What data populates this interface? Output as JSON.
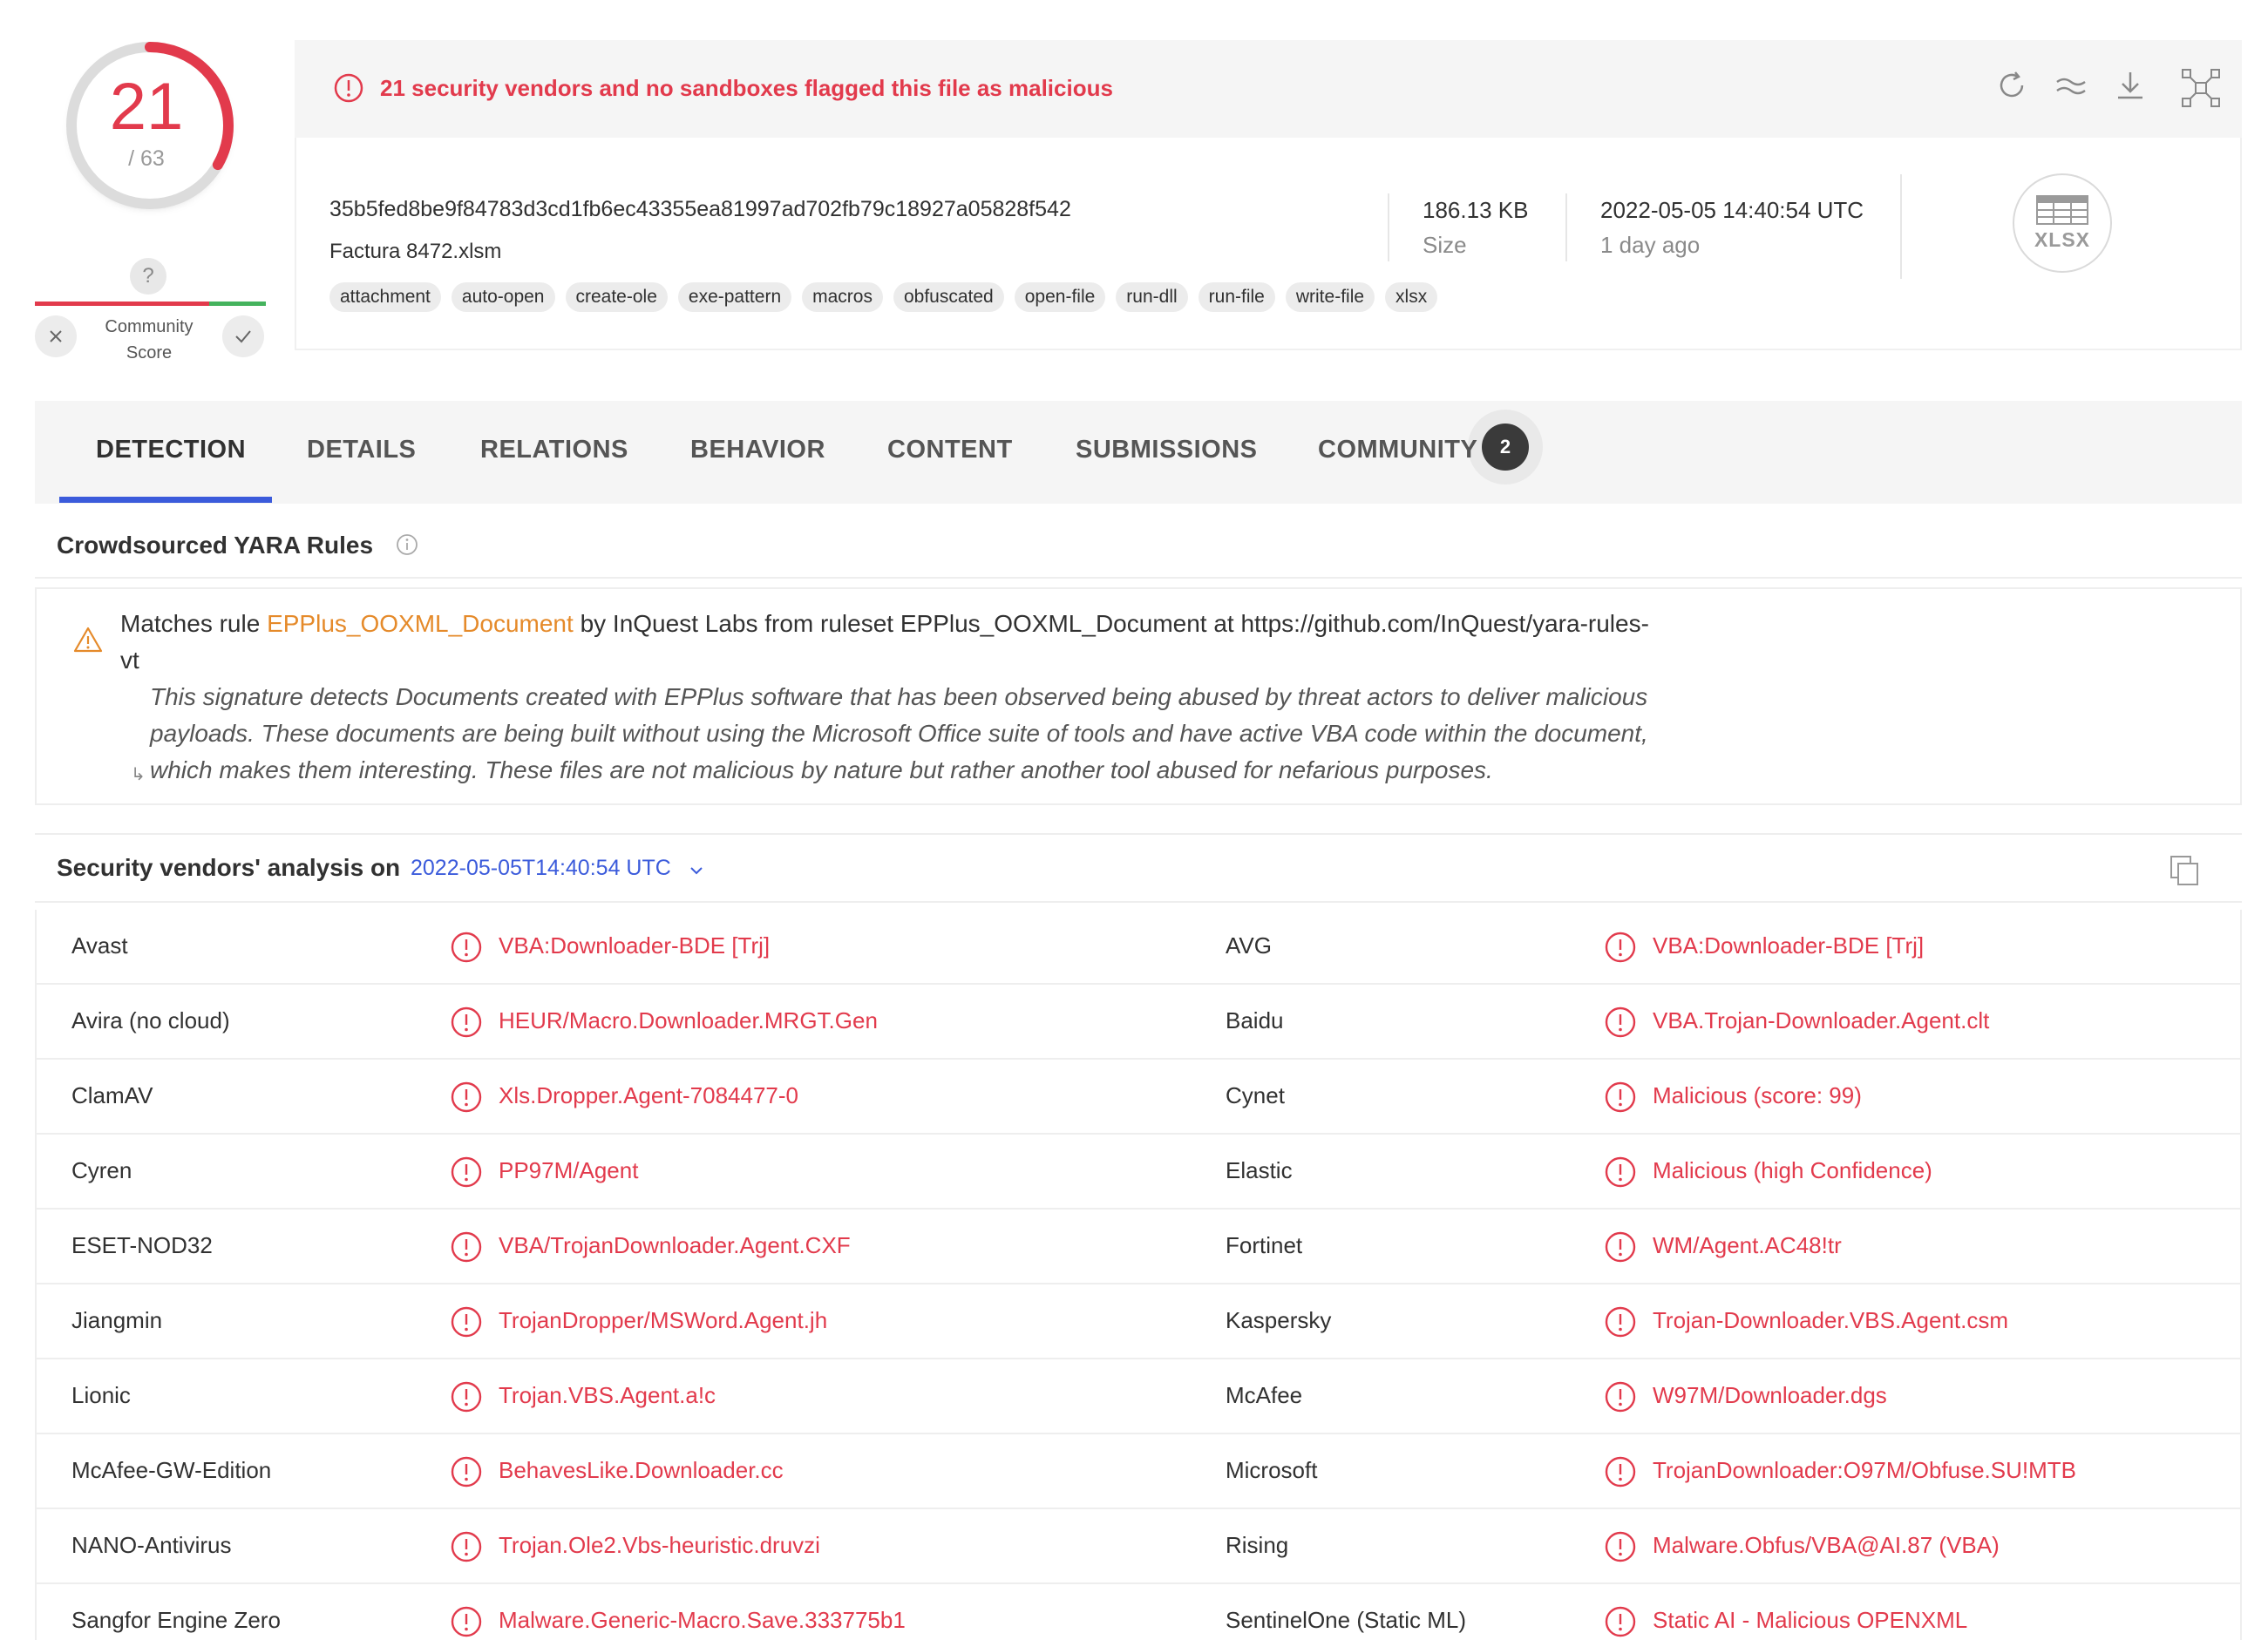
{
  "score": {
    "detections": "21",
    "total": "/ 63"
  },
  "community": {
    "unknown_mark": "?",
    "label_line1": "Community",
    "label_line2": "Score"
  },
  "alert": {
    "text": "21 security vendors and no sandboxes flagged this file as malicious"
  },
  "file": {
    "hash": "35b5fed8be9f84783d3cd1fb6ec43355ea81997ad702fb79c18927a05828f542",
    "name": "Factura 8472.xlsm",
    "tags": [
      "attachment",
      "auto-open",
      "create-ole",
      "exe-pattern",
      "macros",
      "obfuscated",
      "open-file",
      "run-dll",
      "run-file",
      "write-file",
      "xlsx"
    ],
    "size_value": "186.13 KB",
    "size_label": "Size",
    "date_value": "2022-05-05 14:40:54 UTC",
    "date_ago": "1 day ago",
    "type_label": "XLSX"
  },
  "tabs": [
    {
      "label": "DETECTION",
      "active": true
    },
    {
      "label": "DETAILS"
    },
    {
      "label": "RELATIONS"
    },
    {
      "label": "BEHAVIOR"
    },
    {
      "label": "CONTENT"
    },
    {
      "label": "SUBMISSIONS"
    },
    {
      "label": "COMMUNITY",
      "badge": "2"
    }
  ],
  "yara": {
    "title": "Crowdsourced YARA Rules",
    "prefix": "Matches rule ",
    "rule": "EPPlus_OOXML_Document",
    "suffix": " by InQuest Labs from ruleset EPPlus_OOXML_Document at https://github.com/InQuest/yara-rules-",
    "suffix_wrap": "vt",
    "desc_lines": [
      "This signature detects Documents created with EPPlus software that has been observed being abused by threat actors to deliver malicious",
      "payloads. These documents are being built without using the Microsoft Office suite of tools and have active VBA code within the document,",
      "which makes them interesting. These files are not malicious by nature but rather another tool abused for nefarious purposes."
    ],
    "wrap_mark": "↳"
  },
  "vendors": {
    "title": "Security vendors' analysis on",
    "date": "2022-05-05T14:40:54 UTC",
    "rows": [
      [
        {
          "name": "Avast",
          "result": "VBA:Downloader-BDE [Trj]"
        },
        {
          "name": "AVG",
          "result": "VBA:Downloader-BDE [Trj]"
        }
      ],
      [
        {
          "name": "Avira (no cloud)",
          "result": "HEUR/Macro.Downloader.MRGT.Gen"
        },
        {
          "name": "Baidu",
          "result": "VBA.Trojan-Downloader.Agent.clt"
        }
      ],
      [
        {
          "name": "ClamAV",
          "result": "Xls.Dropper.Agent-7084477-0"
        },
        {
          "name": "Cynet",
          "result": "Malicious (score: 99)"
        }
      ],
      [
        {
          "name": "Cyren",
          "result": "PP97M/Agent"
        },
        {
          "name": "Elastic",
          "result": "Malicious (high Confidence)"
        }
      ],
      [
        {
          "name": "ESET-NOD32",
          "result": "VBA/TrojanDownloader.Agent.CXF"
        },
        {
          "name": "Fortinet",
          "result": "WM/Agent.AC48!tr"
        }
      ],
      [
        {
          "name": "Jiangmin",
          "result": "TrojanDropper/MSWord.Agent.jh"
        },
        {
          "name": "Kaspersky",
          "result": "Trojan-Downloader.VBS.Agent.csm"
        }
      ],
      [
        {
          "name": "Lionic",
          "result": "Trojan.VBS.Agent.a!c"
        },
        {
          "name": "McAfee",
          "result": "W97M/Downloader.dgs"
        }
      ],
      [
        {
          "name": "McAfee-GW-Edition",
          "result": "BehavesLike.Downloader.cc"
        },
        {
          "name": "Microsoft",
          "result": "TrojanDownloader:O97M/Obfuse.SU!MTB"
        }
      ],
      [
        {
          "name": "NANO-Antivirus",
          "result": "Trojan.Ole2.Vbs-heuristic.druvzi"
        },
        {
          "name": "Rising",
          "result": "Malware.Obfus/VBA@AI.87 (VBA)"
        }
      ],
      [
        {
          "name": "Sangfor Engine Zero",
          "result": "Malware.Generic-Macro.Save.333775b1"
        },
        {
          "name": "SentinelOne (Static ML)",
          "result": "Static AI - Malicious OPENXML"
        }
      ]
    ]
  },
  "colors": {
    "malicious": "#e23a4c",
    "accent": "#3b5bdb",
    "rule": "#e58a2a",
    "harmless": "#44b35d"
  }
}
